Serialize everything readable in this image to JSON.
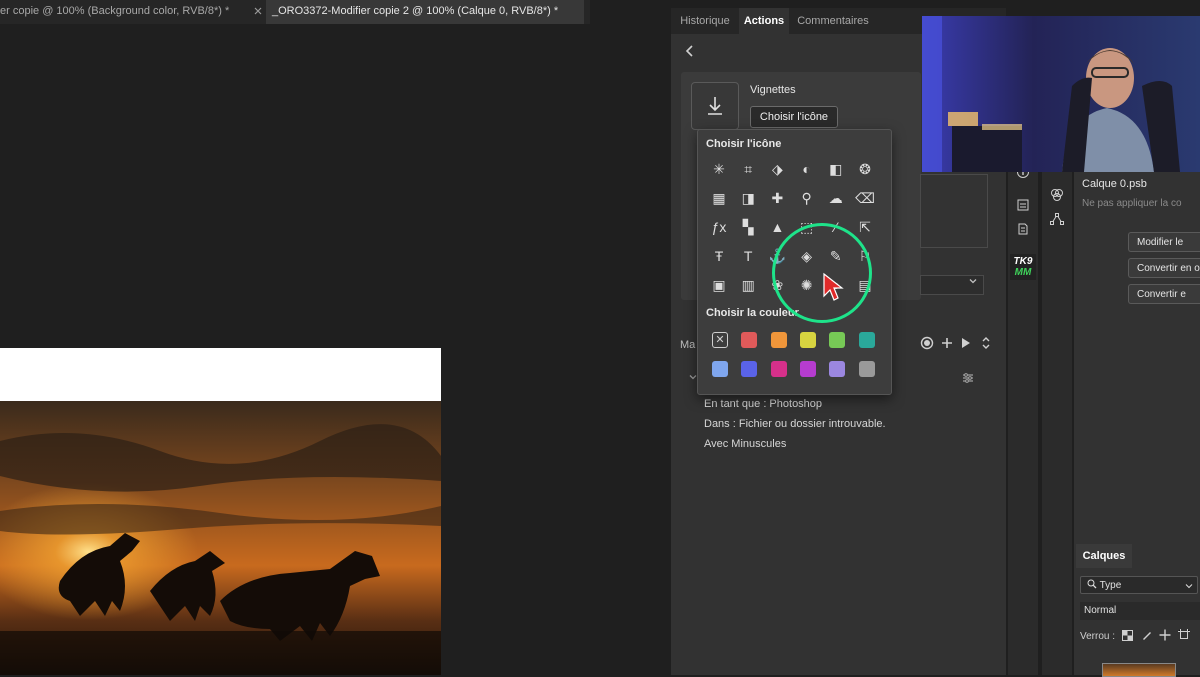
{
  "doc_tabs": [
    {
      "label": "er copie @ 100% (Background color, RVB/8*) *",
      "close": "×"
    },
    {
      "label": "_ORO3372-Modifier copie 2 @ 100% (Calque 0, RVB/8*) *"
    }
  ],
  "panel_tabs": [
    "Historique",
    "Actions",
    "Commentaires"
  ],
  "action_card": {
    "title": "Vignettes",
    "choose_icon_button": "Choisir l'icône"
  },
  "icon_picker": {
    "icon_heading": "Choisir l'icône",
    "color_heading": "Choisir la couleur",
    "icons": [
      "magic-wand-icon",
      "crop-icon",
      "layers-move-icon",
      "adjustment-icon",
      "gradient-icon",
      "aperture-icon",
      "grid-icon",
      "mask-icon",
      "healing-brush-icon",
      "magnifier-icon",
      "cloud-icon",
      "eraser-icon",
      "fx-icon",
      "qr-icon",
      "triangle-icon",
      "transform-icon",
      "wand-icon",
      "export-icon",
      "text-cursor-icon",
      "text-icon",
      "anchor-icon",
      "layers-icon",
      "brush-icon",
      "stamp-icon",
      "image-icon",
      "book-icon",
      "flower-icon",
      "sun-icon",
      "bulb-icon",
      "table-icon"
    ],
    "colors": [
      "none",
      "#e05a5a",
      "#f0963a",
      "#d7d440",
      "#77c956",
      "#2aa89a",
      "#7fa6ee",
      "#5a63e8",
      "#d6308a",
      "#b63ccf",
      "#9b87e0",
      "#9a9a9a"
    ]
  },
  "actions_row": {
    "label": "Ma"
  },
  "info_lines": [
    "En tant que : Photoshop",
    "Dans : Fichier ou dossier introuvable.",
    "Avec Minuscules"
  ],
  "right_panel": {
    "title": "Calque 0.psb",
    "placeholder": "Ne pas appliquer la co",
    "buttons": [
      "Modifier le",
      "Convertir en o",
      "Convertir e"
    ]
  },
  "layers_panel": {
    "tab": "Calques",
    "type_filter": "Type",
    "blend_mode": "Normal",
    "lock_label": "Verrou :"
  },
  "toolbar_badge": {
    "line1": "TK9",
    "line2": "MM"
  }
}
